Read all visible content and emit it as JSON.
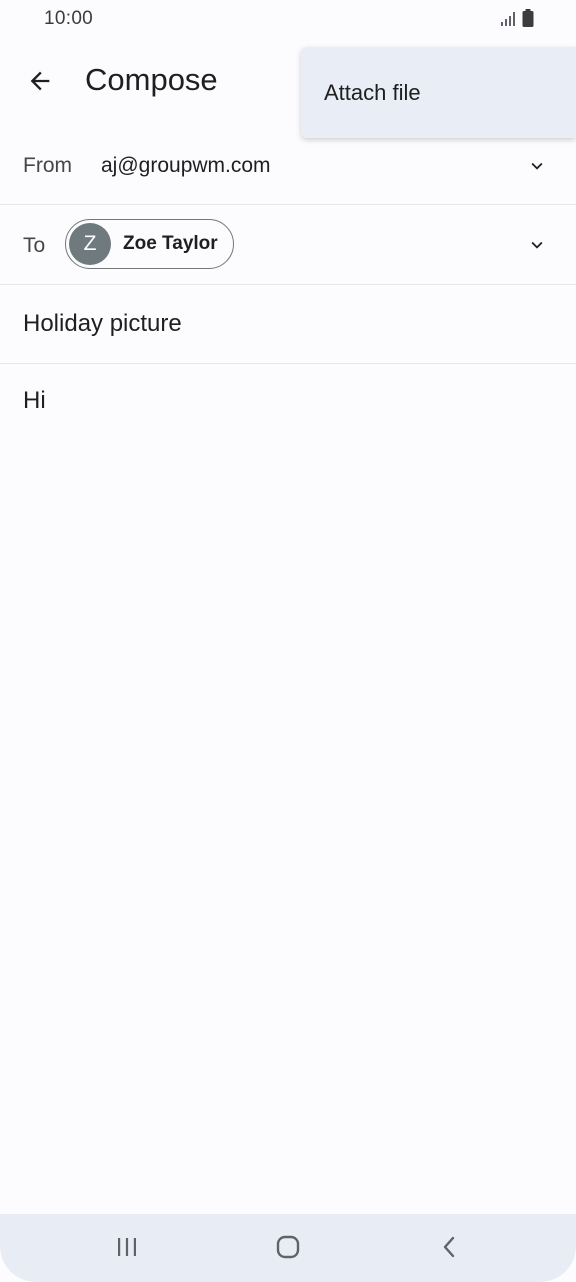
{
  "status_bar": {
    "time": "10:00",
    "icons": [
      "signal-icon",
      "battery-icon"
    ]
  },
  "app_bar": {
    "title": "Compose",
    "back_icon": "arrow-left-icon"
  },
  "overflow_menu": {
    "items": [
      {
        "label": "Attach file"
      }
    ]
  },
  "compose": {
    "from": {
      "label": "From",
      "value": "aj@groupwm.com"
    },
    "to": {
      "label": "To",
      "recipients": [
        {
          "initial": "Z",
          "name": "Zoe Taylor"
        }
      ]
    },
    "subject": "Holiday picture",
    "body": "Hi"
  },
  "nav_bar": {
    "buttons": [
      "recents-icon",
      "home-icon",
      "back-icon"
    ]
  },
  "colors": {
    "background": "#fcfcfe",
    "menu_background": "#e9eef6",
    "nav_background": "#e8edf5",
    "avatar": "#6f7a7e",
    "divider": "#e6e6ea"
  }
}
